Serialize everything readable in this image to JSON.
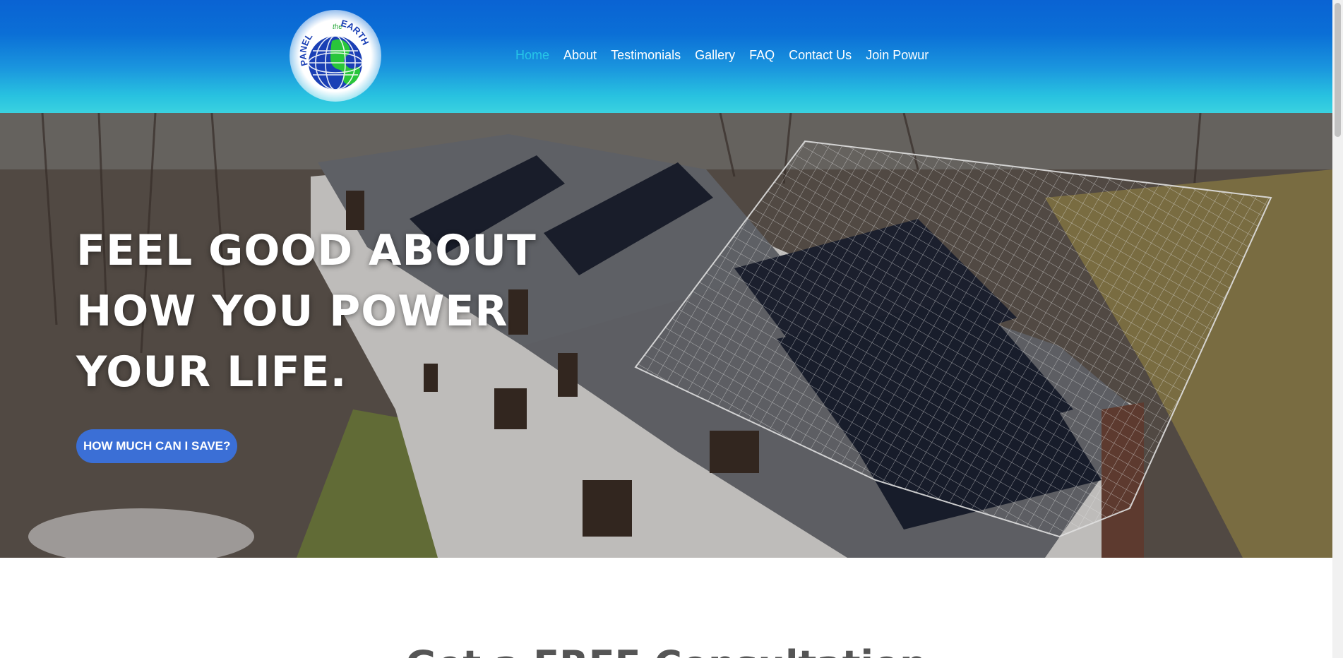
{
  "header": {
    "logo": {
      "text_top": "PANEL",
      "text_mid": "the",
      "text_right": "EARTH",
      "icon": "globe-logo"
    }
  },
  "nav": {
    "items": [
      {
        "label": "Home",
        "active": true
      },
      {
        "label": "About",
        "active": false
      },
      {
        "label": "Testimonials",
        "active": false
      },
      {
        "label": "Gallery",
        "active": false
      },
      {
        "label": "FAQ",
        "active": false
      },
      {
        "label": "Contact Us",
        "active": false
      },
      {
        "label": "Join Powur",
        "active": false
      }
    ]
  },
  "hero": {
    "headline": [
      "FEEL GOOD ABOUT",
      "HOW YOU POWER",
      "YOUR LIFE."
    ],
    "cta_label": "HOW MUCH CAN I SAVE?"
  },
  "section": {
    "title": "Get a FREE Consultation"
  },
  "colors": {
    "header_top": "#0a63d3",
    "header_bottom": "#3ad2e0",
    "nav_active": "#26c6e8",
    "cta": "#3b6fd6"
  }
}
